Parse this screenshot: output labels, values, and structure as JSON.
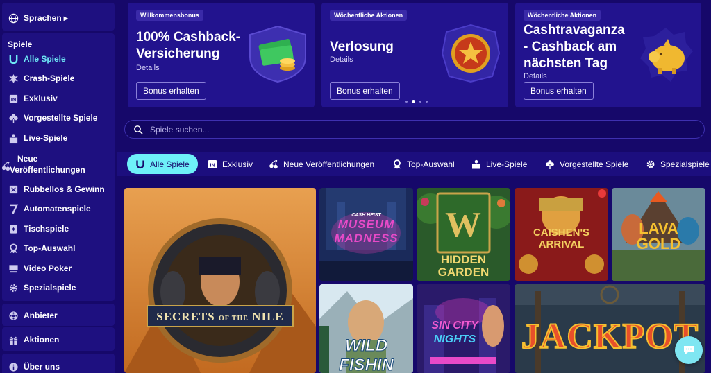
{
  "sidebar": {
    "language": "Sprachen",
    "section_title": "Spiele",
    "items": [
      {
        "label": "Alle Spiele",
        "icon": "horseshoe-icon"
      },
      {
        "label": "Crash-Spiele",
        "icon": "explosion-icon"
      },
      {
        "label": "Exklusiv",
        "icon": "exclusive-icon"
      },
      {
        "label": "Vorgestellte Spiele",
        "icon": "clover-icon"
      },
      {
        "label": "Live-Spiele",
        "icon": "live-dealer-icon"
      },
      {
        "label": "Neue",
        "label2": "Veröffentlichungen",
        "icon": "cherries-icon"
      },
      {
        "label": "Rubbellos & Gewinn",
        "icon": "scratch-card-icon"
      },
      {
        "label": "Automatenspiele",
        "icon": "seven-icon"
      },
      {
        "label": "Tischspiele",
        "icon": "cards-icon"
      },
      {
        "label": "Top-Auswahl",
        "icon": "award-icon"
      },
      {
        "label": "Video Poker",
        "icon": "monitor-icon"
      },
      {
        "label": "Spezialspiele",
        "icon": "gear-icon"
      }
    ],
    "providers": "Anbieter",
    "promotions": "Aktionen",
    "about": "Über uns"
  },
  "promos": [
    {
      "badge": "Willkommensbonus",
      "title_line1": "100% Cashback-",
      "title_line2": "Versicherung",
      "details": "Details",
      "button": "Bonus erhalten"
    },
    {
      "badge": "Wöchentliche Aktionen",
      "title_line1": "Verlosung",
      "details": "Details",
      "button": "Bonus erhalten"
    },
    {
      "badge": "Wöchentliche Aktionen",
      "title_line1": "Cashtravaganza",
      "title_line2": "- Cashback am",
      "title_line3": "nächsten Tag",
      "details": "Details",
      "button": "Bonus erhalten"
    }
  ],
  "search": {
    "placeholder": "Spiele suchen..."
  },
  "categories": [
    {
      "label": "Alle Spiele",
      "icon": "horseshoe-icon"
    },
    {
      "label": "Exklusiv",
      "icon": "exclusive-icon"
    },
    {
      "label": "Neue Veröffentlichungen",
      "icon": "cherries-icon"
    },
    {
      "label": "Top-Auswahl",
      "icon": "award-icon"
    },
    {
      "label": "Live-Spiele",
      "icon": "live-dealer-icon"
    },
    {
      "label": "Vorgestellte Spiele",
      "icon": "clover-icon"
    },
    {
      "label": "Spezialspiele",
      "icon": "gear-icon"
    }
  ],
  "games": [
    {
      "title_line1": "SECRETS",
      "title_line2": "OF THE",
      "title_line3": "NILE"
    },
    {
      "title_line1": "CASH HEIST",
      "title_line2": "MUSEUM",
      "title_line3": "MADNESS"
    },
    {
      "title_line1": "HIDDEN",
      "title_line2": "GARDEN"
    },
    {
      "title_line1": "CAISHEN'S",
      "title_line2": "ARRIVAL"
    },
    {
      "title_line1": "LAVA",
      "title_line2": "GOLD"
    },
    {
      "title_line1": "WILD",
      "title_line2": "FISHIN"
    },
    {
      "title_line1": "SIN CITY",
      "title_line2": "NIGHTS"
    },
    {
      "title_line1": "JACKPOT"
    }
  ],
  "colors": {
    "bg": "#16086a",
    "accent": "#6ef0f8",
    "card": "#22138e"
  }
}
